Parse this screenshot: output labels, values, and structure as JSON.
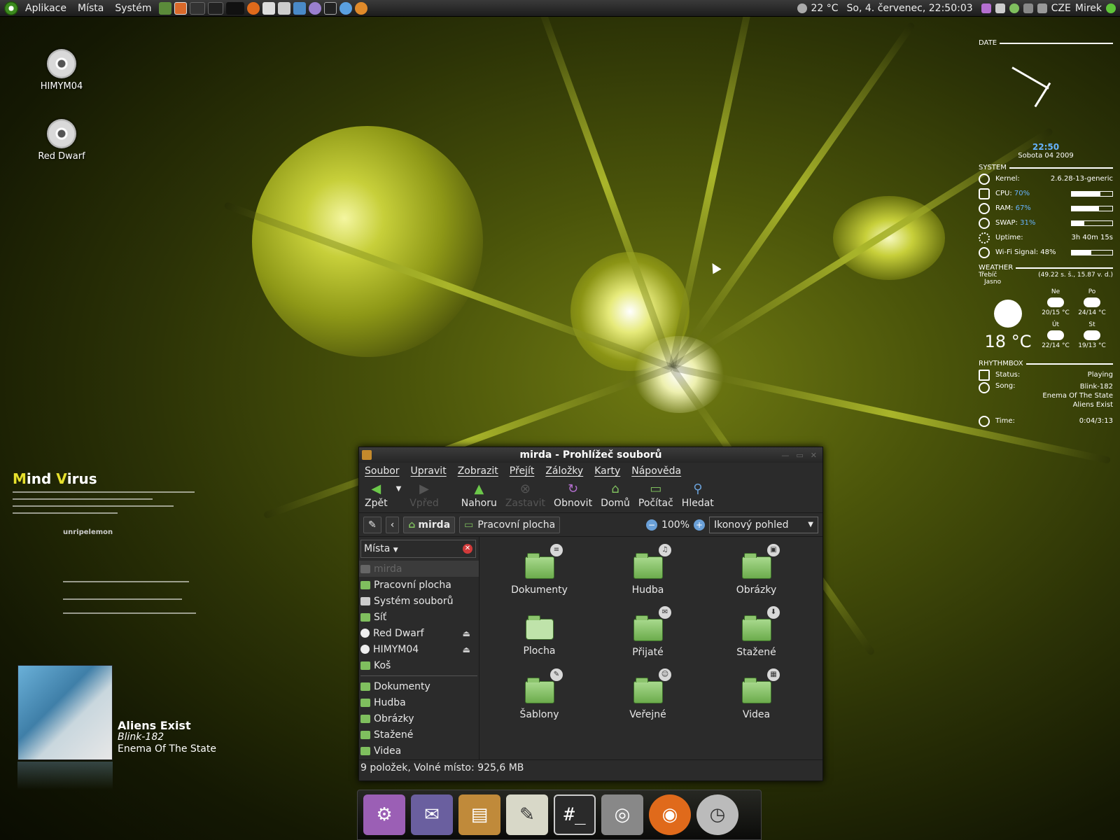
{
  "top_panel": {
    "menus": [
      "Aplikace",
      "Místa",
      "Systém"
    ],
    "temperature": "22 °C",
    "datetime": "So, 4. červenec, 22:50:03",
    "keyboard": "CZE",
    "user": "Mirek"
  },
  "desktop_icons": [
    {
      "label": "HIMYM04"
    },
    {
      "label": "Red Dwarf"
    }
  ],
  "conky": {
    "date_title": "DATE",
    "time": "22:50",
    "date": "Sobota 04 2009",
    "system_title": "SYSTEM",
    "kernel_label": "Kernel:",
    "kernel_value": "2.6.28-13-generic",
    "cpu_label": "CPU:",
    "cpu_value": "70%",
    "cpu_fill": 0.7,
    "ram_label": "RAM:",
    "ram_value": "67%",
    "ram_fill": 0.67,
    "swap_label": "SWAP:",
    "swap_value": "31%",
    "swap_fill": 0.31,
    "uptime_label": "Uptime:",
    "uptime_value": "3h 40m 15s",
    "wifi_label": "Wi-Fi Signal: 48%",
    "wifi_fill": 0.48,
    "weather_title": "WEATHER",
    "city": "Třebíč",
    "coords": "(49.22 s. š., 15.87 v. d.)",
    "condition": "Jasno",
    "current_temp": "18 °C",
    "forecast": [
      {
        "day": "Ne",
        "temp": "20/15 °C"
      },
      {
        "day": "Po",
        "temp": "24/14 °C"
      },
      {
        "day": "Út",
        "temp": "22/14 °C"
      },
      {
        "day": "St",
        "temp": "19/13 °C"
      }
    ],
    "rhythmbox_title": "RHYTHMBOX",
    "status_label": "Status:",
    "status_value": "Playing",
    "song_label": "Song:",
    "song_artist": "Blink-182",
    "song_album": "Enema Of The State",
    "song_title": "Aliens Exist",
    "time_label": "Time:",
    "time_value": "0:04/3:13"
  },
  "mind_virus": {
    "title_m": "M",
    "title_rest1": "ind ",
    "title_v": "V",
    "title_rest2": "irus",
    "sub": "unripelemon"
  },
  "now_playing": {
    "title": "Aliens Exist",
    "artist": "Blink-182",
    "album": "Enema Of The State"
  },
  "window": {
    "title": "mirda - Prohlížeč souborů",
    "menus": [
      "Soubor",
      "Upravit",
      "Zobrazit",
      "Přejít",
      "Záložky",
      "Karty",
      "Nápověda"
    ],
    "toolbar": {
      "back": "Zpět",
      "forward": "Vpřed",
      "up": "Nahoru",
      "stop": "Zastavit",
      "reload": "Obnovit",
      "home": "Domů",
      "computer": "Počítač",
      "search": "Hledat"
    },
    "crumbs": {
      "home": "mirda",
      "desktop": "Pracovní plocha"
    },
    "zoom": "100%",
    "view": "Ikonový pohled",
    "sidebar_title": "Místa",
    "sidebar_selected": "mirda",
    "sidebar_places": [
      "Pracovní plocha",
      "Systém souborů",
      "Síť",
      "Red Dwarf",
      "HIMYM04",
      "Koš"
    ],
    "sidebar_bookmarks": [
      "Dokumenty",
      "Hudba",
      "Obrázky",
      "Stažené",
      "Videa"
    ],
    "files": [
      {
        "name": "Dokumenty",
        "emblem": "≡"
      },
      {
        "name": "Hudba",
        "emblem": "♫"
      },
      {
        "name": "Obrázky",
        "emblem": "▣"
      },
      {
        "name": "Plocha",
        "emblem": ""
      },
      {
        "name": "Přijaté",
        "emblem": "✉"
      },
      {
        "name": "Stažené",
        "emblem": "⬇"
      },
      {
        "name": "Šablony",
        "emblem": "✎"
      },
      {
        "name": "Veřejné",
        "emblem": "☺"
      },
      {
        "name": "Videa",
        "emblem": "▦"
      }
    ],
    "status": "9 položek, Volné místo: 925,6 MB"
  },
  "dock": [
    {
      "icon": "settings-icon",
      "glyph": "⚙",
      "color": "#9b5fb5"
    },
    {
      "icon": "pidgin-icon",
      "glyph": "✉",
      "color": "#6a5f9f"
    },
    {
      "icon": "file-cabinet-icon",
      "glyph": "▤",
      "color": "#c08a3a"
    },
    {
      "icon": "text-editor-icon",
      "glyph": "✎",
      "color": "#d8d8c8"
    },
    {
      "icon": "terminal-icon",
      "glyph": "#_",
      "color": "#2a2a2a"
    },
    {
      "icon": "disk-utility-icon",
      "glyph": "◎",
      "color": "#888888"
    },
    {
      "icon": "firefox-icon",
      "glyph": "◉",
      "color": "#e06a1b"
    },
    {
      "icon": "clock-icon",
      "glyph": "◷",
      "color": "#bbbbbb"
    }
  ]
}
